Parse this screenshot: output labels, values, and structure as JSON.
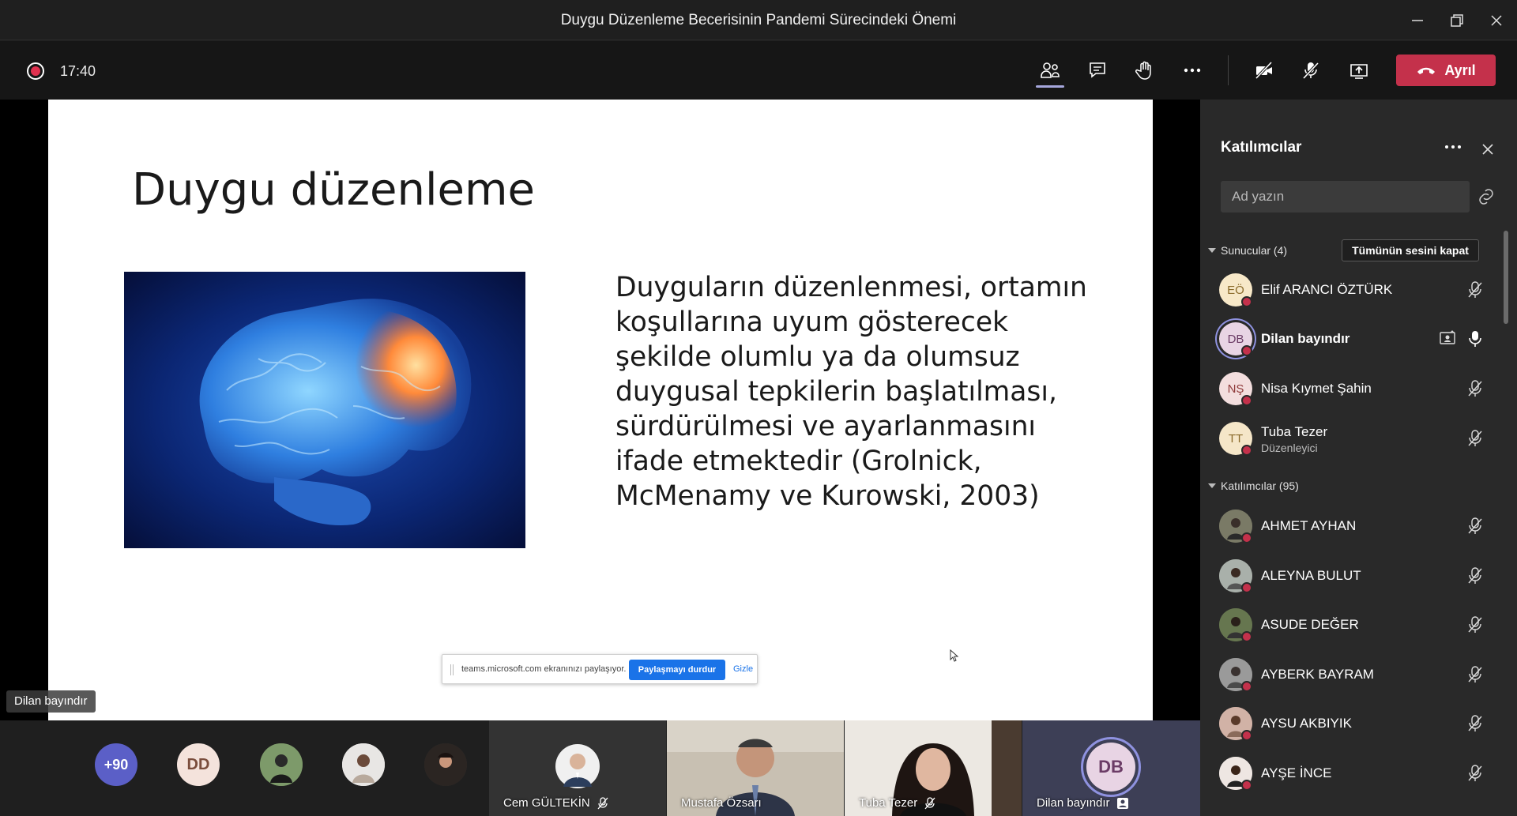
{
  "window": {
    "title": "Duygu Düzenleme Becerisinin Pandemi Sürecindeki Önemi"
  },
  "toolbar": {
    "timer": "17:40",
    "leave_label": "Ayrıl"
  },
  "slide": {
    "title": "Duygu düzenleme",
    "body": "Duyguların düzenlenmesi, ortamın koşullarına uyum gösterecek şekilde olumlu ya da olumsuz duygusal tepkilerin başlatılması, sürdürülmesi ve ayarlanmasını ifade etmektedir (Grolnick, McMenamy ve Kurowski, 2003)"
  },
  "share_bar": {
    "message": "teams.microsoft.com ekranınızı paylaşıyor.",
    "stop_label": "Paylaşmayı durdur",
    "hide_label": "Gizle"
  },
  "presenter_tag": "Dilan bayındır",
  "gallery": {
    "overflow_count": "+90",
    "dd_initials": "DD",
    "tiles": [
      {
        "name": "Cem GÜLTEKİN"
      },
      {
        "name": "Mustafa Özsarı"
      },
      {
        "name": "Tuba Tezer"
      },
      {
        "name": "Dilan bayındır",
        "initials": "DB"
      }
    ]
  },
  "panel": {
    "title": "Katılımcılar",
    "search_placeholder": "Ad yazın",
    "presenters_label": "Sunucular (4)",
    "mute_all_label": "Tümünün sesini kapat",
    "attendees_label": "Katılımcılar (95)",
    "presenters": [
      {
        "initials": "EÖ",
        "name": "Elif ARANCI ÖZTÜRK"
      },
      {
        "initials": "DB",
        "name": "Dilan bayındır"
      },
      {
        "initials": "NŞ",
        "name": "Nisa Kıymet Şahin"
      },
      {
        "initials": "TT",
        "name": "Tuba Tezer",
        "role": "Düzenleyici"
      }
    ],
    "attendees": [
      {
        "name": "AHMET AYHAN"
      },
      {
        "name": "ALEYNA BULUT"
      },
      {
        "name": "ASUDE DEĞER"
      },
      {
        "name": "AYBERK BAYRAM"
      },
      {
        "name": "AYSU AKBIYIK"
      },
      {
        "name": "AYŞE İNCE"
      }
    ]
  }
}
